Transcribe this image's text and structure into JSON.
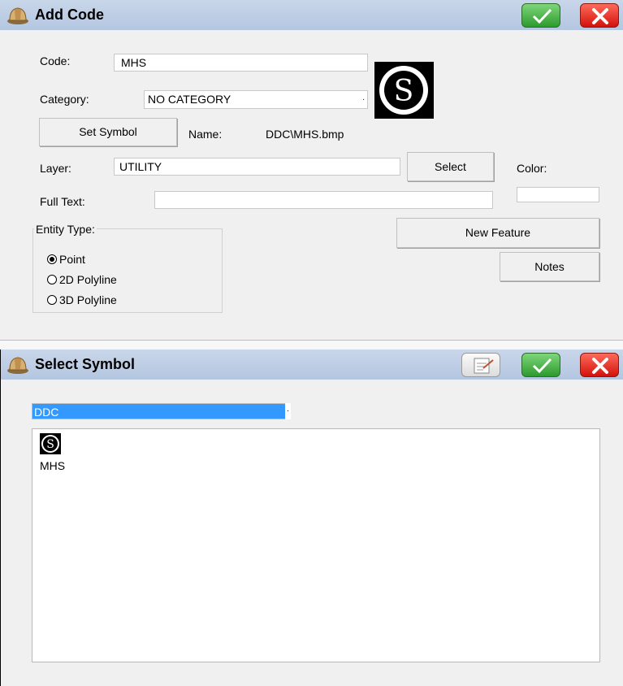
{
  "add_code": {
    "title": "Add Code",
    "code_label": "Code:",
    "code_value": "MHS",
    "category_label": "Category:",
    "category_value": "NO CATEGORY",
    "set_symbol_label": "Set Symbol",
    "name_label": "Name:",
    "name_value": "DDC\\MHS.bmp",
    "layer_label": "Layer:",
    "layer_value": "UTILITY",
    "select_label": "Select",
    "color_label": "Color:",
    "full_text_label": "Full Text:",
    "full_text_value": "",
    "entity_type_label": "Entity Type:",
    "entity_types": [
      "Point",
      "2D Polyline",
      "3D Polyline"
    ],
    "selected_entity": "Point",
    "new_feature_label": "New Feature",
    "notes_label": "Notes",
    "symbol_glyph": "S"
  },
  "select_symbol": {
    "title": "Select Symbol",
    "library_value": "DDC",
    "symbols": [
      {
        "label": "MHS",
        "glyph": "S"
      }
    ]
  },
  "colors": {
    "titlebar": "#b9cbe4",
    "selection": "#3399ff",
    "ok_green": "#2d9a2d",
    "cancel_red": "#d2120c"
  }
}
